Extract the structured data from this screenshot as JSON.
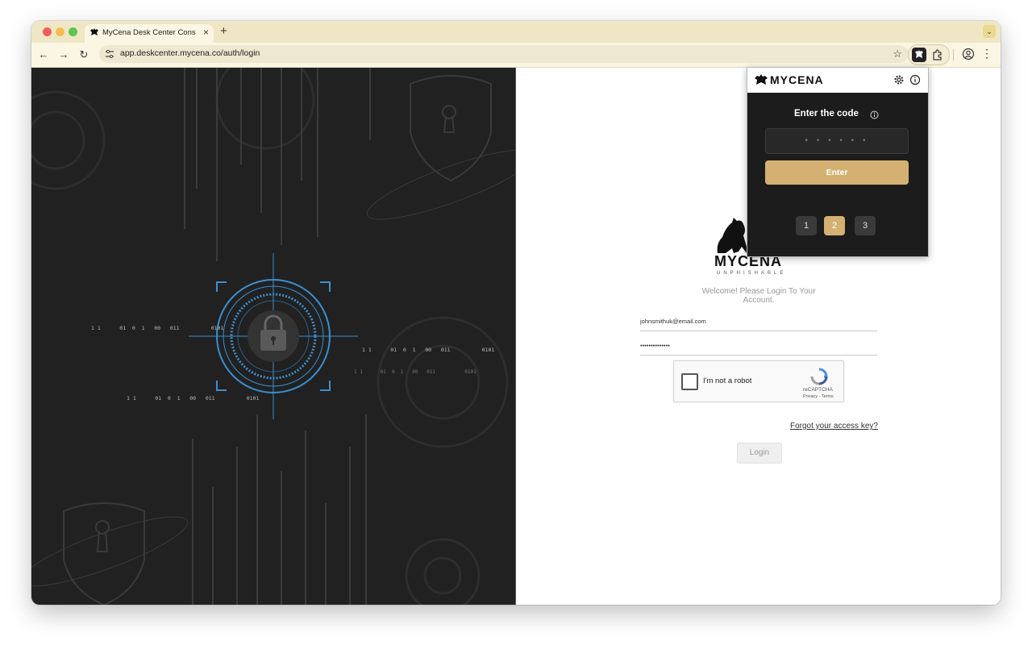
{
  "browser": {
    "tab_title": "MyCena Desk Center Console",
    "tab_close": "×",
    "new_tab": "+",
    "tab_menu": "⌄",
    "url": "app.deskcenter.mycena.co/auth/login",
    "nav": {
      "back": "←",
      "forward": "→",
      "reload": "↻"
    },
    "star": "☆",
    "menu": "⋮"
  },
  "login": {
    "brand": "MYCENA",
    "tagline": "UNPHISHABLE",
    "welcome": "Welcome! Please Login To Your Account.",
    "email_value": "johnsmithuk@email.com",
    "password_value": "••••••••••••••",
    "captcha": {
      "label": "I'm not a robot",
      "name": "reCAPTCHA",
      "terms": "Privacy - Terms"
    },
    "forgot_link": "Forgot your access key?",
    "login_button": "Login"
  },
  "extension_popup": {
    "brand": "MYCENA",
    "code_title": "Enter the code",
    "code_placeholder": "• • • • • •",
    "enter_button": "Enter",
    "pages": [
      "1",
      "2",
      "3"
    ],
    "active_page": "2"
  },
  "left_panel": {
    "binary_lines": [
      "1 1      01  0  1   00   011          0101",
      "1 1      01  0  1   00   011          0101",
      "1 1      01  0  1   00   011          0101",
      "1 1      01  0  1   00   011          0101"
    ]
  },
  "colors": {
    "accent_gold": "#d4b172",
    "panel_dark": "#212121",
    "scan_blue": "#3a8fd0",
    "tab_strip": "#efe6c6"
  }
}
